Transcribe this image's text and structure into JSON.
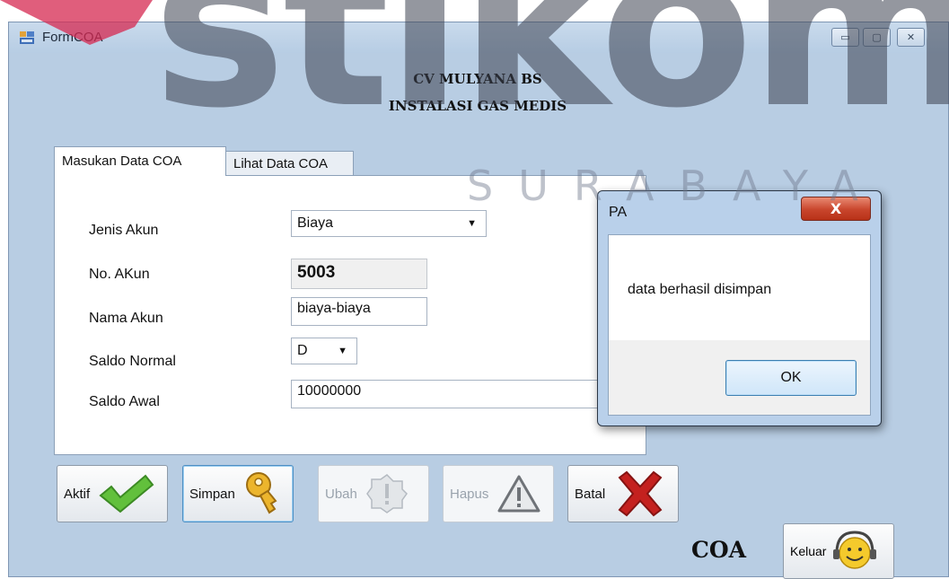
{
  "window": {
    "title": "FormCOA",
    "min_glyph": "▭",
    "max_glyph": "▢",
    "close_glyph": "✕"
  },
  "watermark": {
    "text": "stikom",
    "subtext": "SURABAYA"
  },
  "header": {
    "line1": "CV MULYANA BS",
    "line2": "INSTALASI GAS MEDIS"
  },
  "tabs": [
    {
      "label": "Masukan Data COA",
      "active": true
    },
    {
      "label": "Lihat Data COA",
      "active": false
    }
  ],
  "form": {
    "jenis_akun": {
      "label": "Jenis Akun",
      "value": "Biaya"
    },
    "no_akun": {
      "label": "No. AKun",
      "value": "5003"
    },
    "nama_akun": {
      "label": "Nama Akun",
      "value": "biaya-biaya"
    },
    "saldo_normal": {
      "label": "Saldo Normal",
      "value": "D"
    },
    "saldo_awal": {
      "label": "Saldo Awal",
      "value": "10000000"
    }
  },
  "buttons": {
    "aktif": "Aktif",
    "simpan": "Simpan",
    "ubah": "Ubah",
    "hapus": "Hapus",
    "batal": "Batal",
    "keluar": "Keluar"
  },
  "form_label": "COA",
  "dialog": {
    "title": "PA",
    "message": "data berhasil disimpan",
    "ok_label": "OK",
    "close_glyph": "X"
  },
  "colors": {
    "window_bg": "#b8cde3",
    "aktif_icon": "#5cbf3a",
    "simpan_icon": "#e7b42c",
    "batal_icon": "#c0201e",
    "keluar_icon": "#f3c92e"
  }
}
